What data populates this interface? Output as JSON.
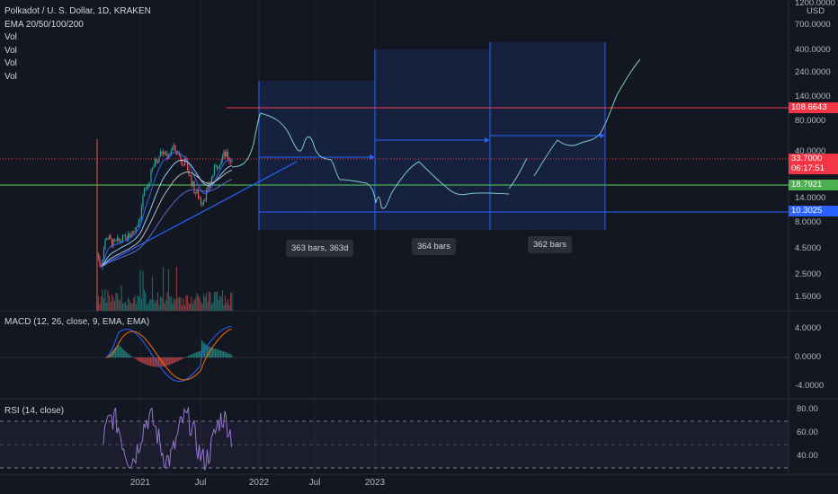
{
  "chart_data": {
    "type": "candlestick",
    "symbol_title": "Polkadot / U. S. Dollar, 1D, KRAKEN",
    "indicators": [
      "EMA 20/50/100/200",
      "Vol",
      "Vol",
      "Vol",
      "Vol"
    ],
    "price_axis": {
      "unit_label": "USD",
      "top_label": "1200.0000",
      "ticks": [
        "700.0000",
        "400.0000",
        "240.0000",
        "140.0000",
        "80.0000",
        "40.0000",
        "14.0000",
        "8.0000",
        "4.5000",
        "2.5000",
        "1.5000"
      ],
      "tick_values": [
        700,
        400,
        240,
        140,
        80,
        40,
        14,
        8,
        4.5,
        2.5,
        1.5
      ],
      "scale": "log"
    },
    "price_tags": [
      {
        "label": "108.6643",
        "value": 108.6643,
        "color": "#f23645"
      },
      {
        "label": "33.7000",
        "value": 33.7,
        "color": "#f23645",
        "sub": "06:17:51"
      },
      {
        "label": "18.7921",
        "value": 18.7921,
        "color": "#4caf50"
      },
      {
        "label": "10.3025",
        "value": 10.3025,
        "color": "#2962ff"
      }
    ],
    "time_axis": {
      "labels": [
        "2021",
        "Jul",
        "2022",
        "Jul",
        "2023"
      ],
      "label_dates": [
        "2021-01-01",
        "2021-07-01",
        "2022-01-01",
        "2022-07-01",
        "2023-01-01"
      ]
    },
    "range_annotations": [
      {
        "label": "363 bars, 363d"
      },
      {
        "label": "364 bars"
      },
      {
        "label": "362 bars"
      }
    ],
    "macd": {
      "title": "MACD (12, 26, close, 9, EMA, EMA)",
      "ticks": [
        "4.0000",
        "0.0000",
        "-4.0000"
      ],
      "tick_values": [
        4,
        0,
        -4
      ]
    },
    "rsi": {
      "title": "RSI (14, close)",
      "ticks": [
        "80.00",
        "60.00",
        "40.00"
      ],
      "tick_values": [
        80,
        60,
        40
      ],
      "band_upper": 70,
      "band_lower": 30
    },
    "colors": {
      "background": "#131722",
      "up": "#26a69a",
      "down": "#ef5350",
      "projection": "#7ec8c8",
      "range_box": "#2962ff",
      "resistance": "#f23645",
      "support": "#4caf50",
      "trendline": "#2962ff"
    }
  }
}
